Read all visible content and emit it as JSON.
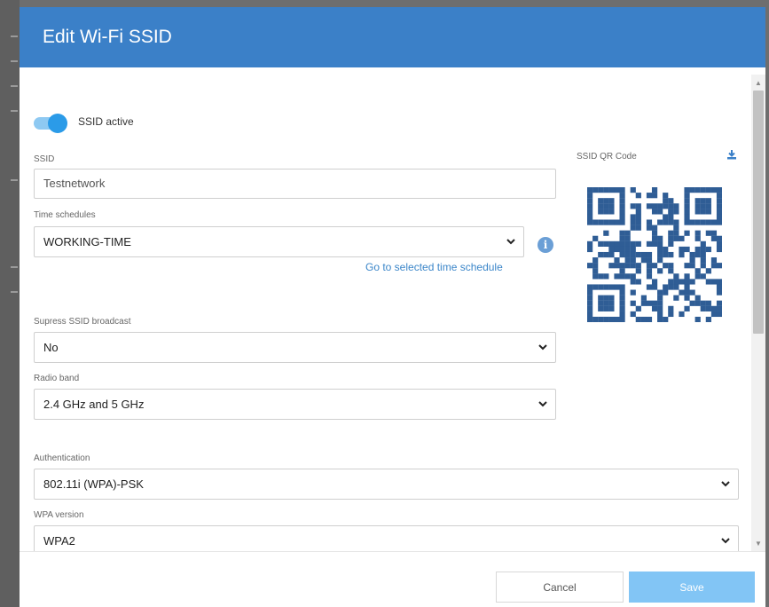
{
  "modal": {
    "title": "Edit Wi-Fi SSID"
  },
  "ssid_active": {
    "label": "SSID active",
    "checked": true
  },
  "ssid": {
    "label": "SSID",
    "value": "Testnetwork"
  },
  "time_schedules": {
    "label": "Time schedules",
    "value": "WORKING-TIME",
    "link": "Go to selected time schedule"
  },
  "qr": {
    "label": "SSID QR Code"
  },
  "suppress_broadcast": {
    "label": "Supress SSID broadcast",
    "value": "No"
  },
  "radio_band": {
    "label": "Radio band",
    "value": "2.4 GHz and 5 GHz"
  },
  "authentication": {
    "label": "Authentication",
    "value": "802.11i (WPA)-PSK"
  },
  "wpa_version": {
    "label": "WPA version",
    "value": "WPA2"
  },
  "footer": {
    "cancel_label": "Cancel",
    "save_label": "Save"
  },
  "colors": {
    "header": "#3b80c8",
    "toggle_on": "#2b9be8",
    "save_button": "#82c5f5",
    "link": "#3b86c9",
    "qr": "#2f5d95"
  }
}
